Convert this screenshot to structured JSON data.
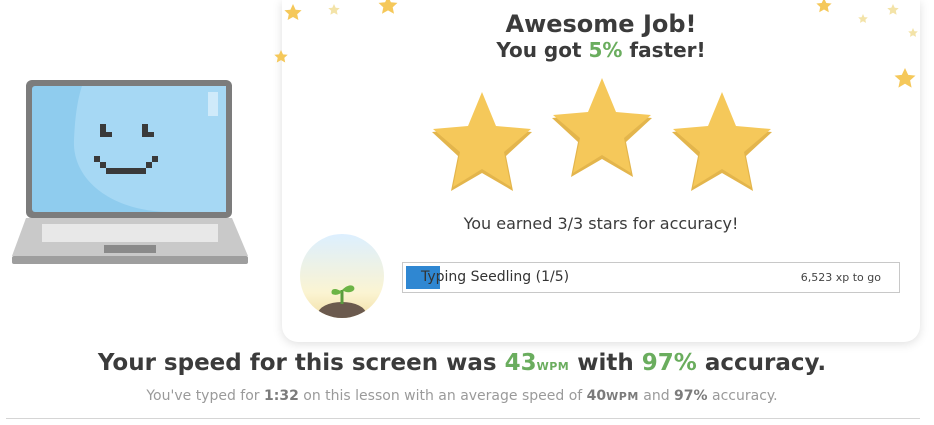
{
  "results": {
    "title": "Awesome Job!",
    "faster_prefix": "You got ",
    "faster_value": "5%",
    "faster_suffix": " faster!",
    "stars_message": "You earned 3/3 stars for accuracy!",
    "stars_earned": 3,
    "stars_total": 3
  },
  "level": {
    "name": "Typing Seedling (1/5)",
    "xp_to_go": "6,523 xp to go",
    "progress_fraction": 0.07,
    "badge_icon": "seedling-icon"
  },
  "stats": {
    "speed_prefix": "Your speed for this screen was ",
    "wpm": "43",
    "wpm_unit": "WPM",
    "middle": " with ",
    "accuracy": "97%",
    "speed_suffix": " accuracy.",
    "summary_prefix": "You've typed for ",
    "time": "1:32",
    "summary_mid": " on this lesson with an average speed of ",
    "avg_wpm": "40",
    "avg_unit": "WPM",
    "summary_and": " and ",
    "avg_accuracy": "97%",
    "summary_suffix": " accuracy."
  },
  "colors": {
    "accent_green": "#6aad5e",
    "star_gold": "#f5c85a",
    "progress_blue": "#2f87d2",
    "screen_blue": "#8fccee"
  }
}
